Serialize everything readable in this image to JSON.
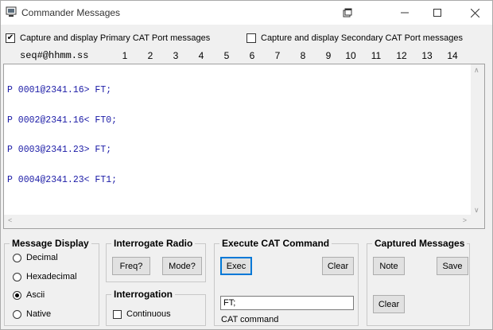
{
  "window": {
    "title": "Commander Messages"
  },
  "capture": {
    "primary_label": "Capture and display Primary CAT Port messages",
    "primary_checked": true,
    "secondary_label": "Capture and display Secondary CAT Port messages",
    "secondary_checked": false,
    "check_glyph": "✔"
  },
  "column_header": {
    "seq_label": "seq#@hhmm.ss",
    "numbers": [
      "1",
      "2",
      "3",
      "4",
      "5",
      "6",
      "7",
      "8",
      "9",
      "10",
      "11",
      "12",
      "13",
      "14"
    ]
  },
  "messages": [
    "P 0001@2341.16> FT;",
    "P 0002@2341.16< FT0;",
    "P 0003@2341.23> FT;",
    "P 0004@2341.23< FT1;"
  ],
  "message_display": {
    "title": "Message Display",
    "options": [
      "Decimal",
      "Hexadecimal",
      "Ascii",
      "Native"
    ],
    "selected": "Ascii"
  },
  "interrogate_radio": {
    "title": "Interrogate Radio",
    "freq_label": "Freq?",
    "mode_label": "Mode?"
  },
  "interrogation": {
    "title": "Interrogation",
    "continuous_label": "Continuous",
    "continuous_checked": false
  },
  "execute_cat": {
    "title": "Execute CAT Command",
    "exec_label": "Exec",
    "clear_label": "Clear",
    "command_value": "FT;",
    "command_caption": "CAT command"
  },
  "captured": {
    "title": "Captured Messages",
    "note_label": "Note",
    "save_label": "Save",
    "clear_label": "Clear"
  },
  "colors": {
    "message_text": "#1a1aa6",
    "focus_border": "#0078d7"
  }
}
